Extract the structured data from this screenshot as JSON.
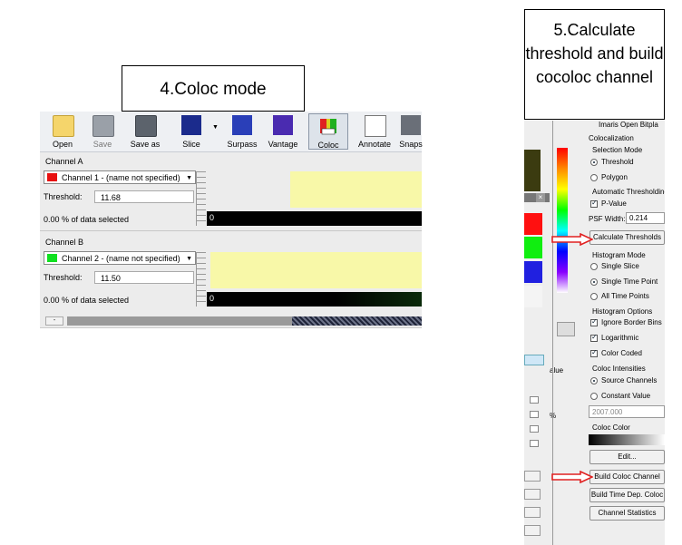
{
  "callouts": {
    "coloc_mode": "4.Coloc mode",
    "calculate": "5.Calculate threshold and build cocoloc channel"
  },
  "toolbar": {
    "buttons": [
      {
        "label": "Open",
        "icon": "folder-open-icon"
      },
      {
        "label": "Save",
        "icon": "save-icon"
      },
      {
        "label": "Save as",
        "icon": "save-as-icon"
      },
      {
        "label": "Slice",
        "icon": "slice-icon"
      },
      {
        "label": "Surpass",
        "icon": "surpass-icon"
      },
      {
        "label": "Vantage",
        "icon": "vantage-icon"
      },
      {
        "label": "Coloc",
        "icon": "coloc-icon"
      },
      {
        "label": "Annotate",
        "icon": "annotate-icon"
      },
      {
        "label": "Snaps",
        "icon": "snapshot-icon"
      }
    ]
  },
  "channel_a": {
    "section": "Channel A",
    "selected": "Channel 1 - (name not specified)",
    "color": "#e81010",
    "threshold_label": "Threshold:",
    "threshold_value": "11.68",
    "selected_pct": "0.00 % of data selected",
    "bar_value": "0"
  },
  "channel_b": {
    "section": "Channel B",
    "selected": "Channel 2 - (name not specified)",
    "color": "#10e020",
    "threshold_label": "Threshold:",
    "threshold_value": "11.50",
    "selected_pct": "0.00 % of data selected",
    "bar_value": "0"
  },
  "right_panel": {
    "top_tabs": "Imaris Open   Bitpla",
    "colocalization": "Colocalization",
    "selection_mode": "Selection Mode",
    "threshold": "Threshold",
    "polygon": "Polygon",
    "auto_threshold": "Automatic Thresholding",
    "p_value": "P-Value",
    "psf_label": "PSF Width:",
    "psf_value": "0.214",
    "calc_button": "Calculate Thresholds",
    "histogram_mode": "Histogram Mode",
    "single_slice": "Single Slice",
    "single_time_point": "Single Time Point",
    "all_time_points": "All Time Points",
    "histogram_options": "Histogram Options",
    "ignore_border": "Ignore Border Bins",
    "logarithmic": "Logarithmic",
    "color_coded": "Color Coded",
    "coloc_intensities": "Coloc Intensities",
    "source_channels": "Source Channels",
    "constant_value": "Constant Value",
    "constant_input": "2007.000",
    "coloc_color": "Coloc Color",
    "edit_button": "Edit...",
    "build_button": "Build Coloc Channel",
    "build_time_button": "Build Time Dep. Coloc",
    "stats_button": "Channel Statistics",
    "value_label": "alue",
    "pct_fragment": "%"
  }
}
